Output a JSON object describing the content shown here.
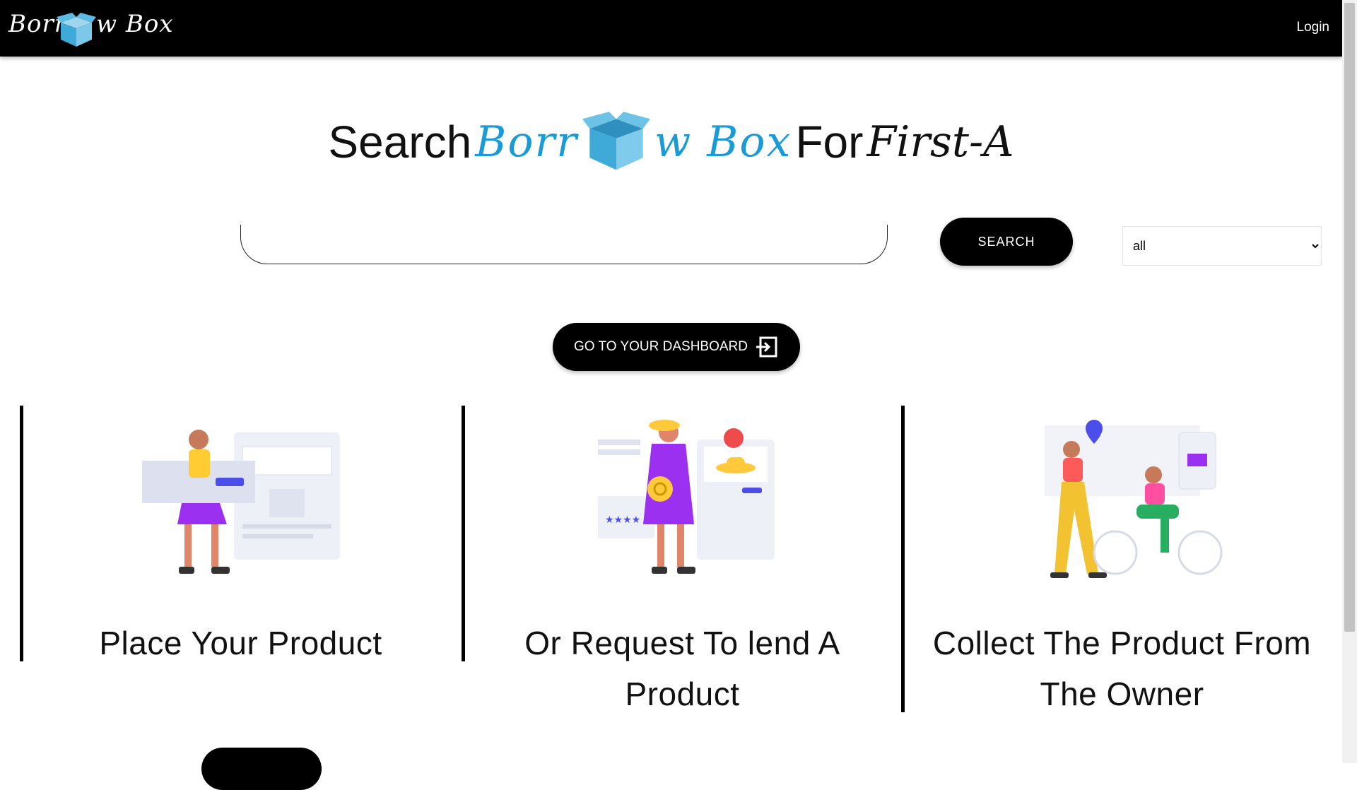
{
  "navbar": {
    "logo_left": "Borr",
    "logo_right": "w Box",
    "login_label": "Login"
  },
  "hero": {
    "word_search": "Search",
    "brand_left": "Borr",
    "brand_right": "w Box",
    "word_for": "For",
    "word_first": "First-A"
  },
  "search": {
    "value": "",
    "button_label": "SEARCH",
    "category_selected": "all"
  },
  "dashboard": {
    "button_label": "GO TO YOUR DASHBOARD"
  },
  "steps": [
    {
      "label": "Place Your Product"
    },
    {
      "label": "Or Request To lend A Product"
    },
    {
      "label": "Collect The Product From The Owner"
    }
  ],
  "colors": {
    "navbar_bg": "#000000",
    "brand_blue": "#1a9ad6",
    "button_bg": "#000000"
  },
  "icons": [
    "open-box-icon",
    "enter-dashboard-icon",
    "chevron-down-icon"
  ]
}
